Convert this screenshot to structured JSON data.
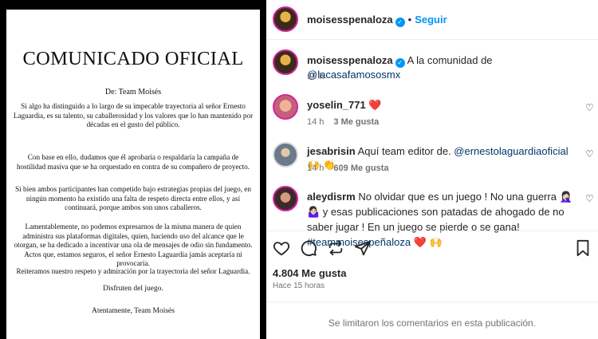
{
  "document": {
    "title": "COMUNICADO OFICIAL",
    "from": "De: Team Moisés",
    "paragraphs": [
      "Si algo ha distinguido a lo largo de su impecable trayectoria al señor Ernesto Laguardia, es su talento, su caballerosidad y los valores que lo han mantenido por décadas en el gusto del público.",
      "Con base en ello, dudamos que él aprobaría o respaldaría la campaña de hostilidad masiva que se ha orquestado en contra de su compañero de proyecto.",
      "Si bien ambos participantes han competido bajo estrategias propias del juego, en ningún momento ha existido una falta de respeto directa entre ellos, y así continuará, porque ambos son unos caballeros.",
      "Lamentablemente, no podemos expresarnos de la misma manera de quien administra sus plataformas digitales, quien, haciendo uso del alcance que le otorgan, se ha dedicado a incentivar una ola de mensajes de odio sin fundamento. Actos que, estamos seguros, el señor Ernesto Laguardia jamás aceptaría ni provocaría.",
      "Reiteramos nuestro respeto y admiración por la trayectoria del señor Laguardia."
    ],
    "enjoy": "Disfruten del juego.",
    "signature": "Atentamente, Team Moisés"
  },
  "header": {
    "username": "moisesspenaloza",
    "dot": "•",
    "follow_label": "Seguir"
  },
  "caption": {
    "username": "moisesspenaloza",
    "text": "A la comunidad de ",
    "mention": "@lacasafamososmx",
    "time": "15 h"
  },
  "comments": [
    {
      "username": "yoselin_771",
      "text": "❤️",
      "time": "14 h",
      "likes": "3 Me gusta"
    },
    {
      "username": "jesabrisin",
      "text": "Aquí team editor de. ",
      "mention": "@ernestolaguardiaoficial",
      "emoji": " 🙌 👏",
      "time": "14 h",
      "likes": "609 Me gusta"
    },
    {
      "username": "aleydisrm",
      "text": "No olvidar que es un juego ! No una guerra 🤦🏻‍♀️ 🤷🏻‍♀️ y esas publicaciones son patadas de ahogado de no saber jugar ! En un juego se pierde o se gana! ",
      "hashtag": "#teammoisespeñaloza",
      "emoji": " ❤️ 🙌"
    }
  ],
  "stats": {
    "likes": "4.804 Me gusta",
    "ago": "Hace 15 horas",
    "comments_limited": "Se limitaron los comentarios en esta publicación."
  },
  "icons": {
    "verified": "✓",
    "heart_small": "♡"
  }
}
